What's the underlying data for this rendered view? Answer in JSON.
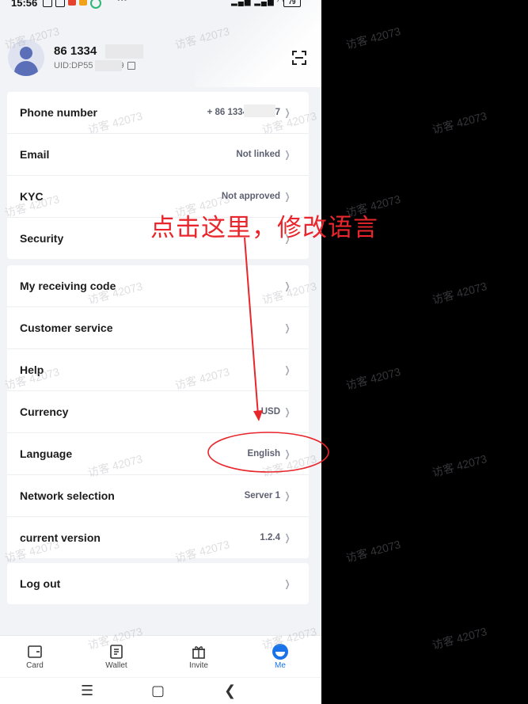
{
  "status_bar": {
    "time": "15:56",
    "more": "···",
    "battery": "79"
  },
  "profile": {
    "phone": "86 1334   7",
    "uid": "UID:DP55   9"
  },
  "account_rows": [
    {
      "label": "Phone number",
      "value": "+ 86 1334   7"
    },
    {
      "label": "Email",
      "value": "Not linked"
    },
    {
      "label": "KYC",
      "value": "Not approved"
    },
    {
      "label": "Security",
      "value": ""
    }
  ],
  "settings_rows": [
    {
      "label": "My receiving code",
      "value": ""
    },
    {
      "label": "Customer service",
      "value": ""
    },
    {
      "label": "Help",
      "value": ""
    },
    {
      "label": "Currency",
      "value": "USD"
    },
    {
      "label": "Language",
      "value": "English"
    },
    {
      "label": "Network selection",
      "value": "Server 1"
    },
    {
      "label": "current version",
      "value": "1.2.4"
    }
  ],
  "logout": {
    "label": "Log out"
  },
  "bottom_nav": [
    {
      "label": "Card",
      "icon": "card-icon"
    },
    {
      "label": "Wallet",
      "icon": "wallet-icon"
    },
    {
      "label": "Invite",
      "icon": "gift-icon"
    },
    {
      "label": "Me",
      "icon": "me-icon"
    }
  ],
  "annotation": {
    "text": "点击这里，修改语言",
    "color": "#e8262b"
  },
  "watermark": "访客 42073",
  "colors": {
    "accent": "#1a73e8",
    "annotation": "#e8262b"
  }
}
